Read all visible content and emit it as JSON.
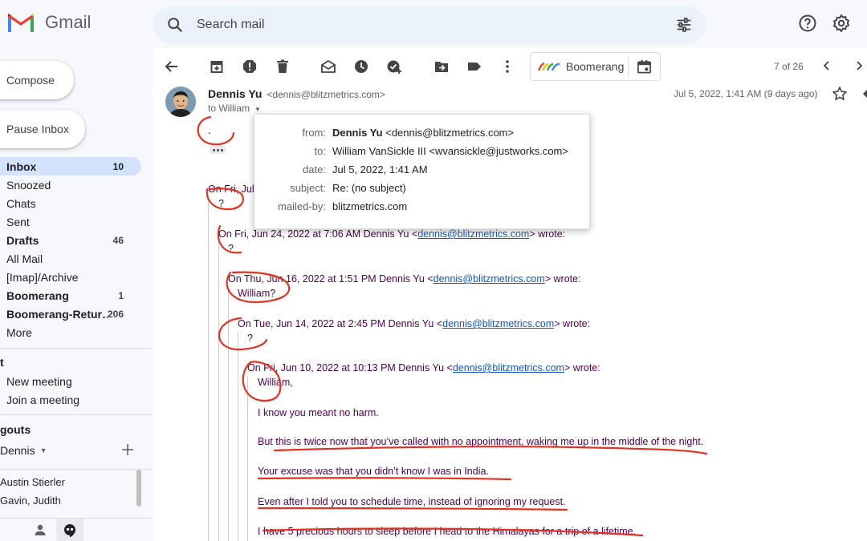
{
  "app": {
    "name": "Gmail"
  },
  "search": {
    "placeholder": "Search mail"
  },
  "sidebar": {
    "compose_label": "Compose",
    "pause_label": "Pause Inbox",
    "items": [
      {
        "label": "Inbox",
        "count": "10",
        "bold": true,
        "active": true
      },
      {
        "label": "Snoozed",
        "count": ""
      },
      {
        "label": "Chats",
        "count": ""
      },
      {
        "label": "Sent",
        "count": ""
      },
      {
        "label": "Drafts",
        "count": "46",
        "bold": true
      },
      {
        "label": "All Mail",
        "count": ""
      },
      {
        "label": "[Imap]/Archive",
        "count": ""
      },
      {
        "label": "Boomerang",
        "count": "1",
        "bold": true
      },
      {
        "label": "Boomerang-Retur…",
        "count": "206",
        "bold": true
      },
      {
        "label": "More",
        "count": ""
      }
    ],
    "meet_header": "t",
    "meet_items": [
      "New meeting",
      "Join a meeting"
    ],
    "hangouts_header": "gouts",
    "hangouts_user": "Dennis",
    "contacts": [
      "Austin Stierler",
      "Gavin, Judith"
    ]
  },
  "toolbar": {
    "boomerang_label": "Boomerang",
    "pager": "7 of 26"
  },
  "message": {
    "sender_name": "Dennis Yu",
    "sender_email": "<dennis@blitzmetrics.com>",
    "to": "to William",
    "date": "Jul 5, 2022, 1:41 AM (9 days ago)",
    "body": "."
  },
  "details_popup": {
    "rows": [
      {
        "key": "from:",
        "value_bold": "Dennis Yu",
        "value": " <dennis@blitzmetrics.com>"
      },
      {
        "key": "to:",
        "value_bold": "",
        "value": "William VanSickle III <wvansickle@justworks.com>"
      },
      {
        "key": "date:",
        "value_bold": "",
        "value": "Jul 5, 2022, 1:41 AM"
      },
      {
        "key": "subject:",
        "value_bold": "",
        "value": "Re: (no subject)"
      },
      {
        "key": "mailed-by:",
        "value_bold": "",
        "value": "blitzmetrics.com"
      }
    ]
  },
  "thread": {
    "q1_head": "On Fri, Jul",
    "q1_body": "?",
    "q2_head_pre": "On Fri, Jun 24, 2022 at 7:06 AM Dennis Yu <",
    "q2_link": "dennis@blitzmetrics.com",
    "q2_head_post": "> wrote:",
    "q2_body": "?",
    "q3_head_pre": "On Thu, Jun 16, 2022 at 1:51 PM Dennis Yu <",
    "q3_link": "dennis@blitzmetrics.com",
    "q3_head_post": "> wrote:",
    "q3_body": "William?",
    "q4_head_pre": "On Tue, Jun 14, 2022 at 2:45 PM Dennis Yu <",
    "q4_link": "dennis@blitzmetrics.com",
    "q4_head_post": "> wrote:",
    "q4_body": "?",
    "q5_head_pre": "On Fri, Jun 10, 2022 at 10:13 PM Dennis Yu <",
    "q5_link": "dennis@blitzmetrics.com",
    "q5_head_post": "> wrote:",
    "q5_lines": [
      "William,",
      "I know you meant no harm.",
      "But this is twice now that you’ve called with no appointment, waking me up in the middle of the night.",
      "Your excuse was that you didn’t know I was in India.",
      "Even after I told you to schedule time, instead of ignoring my request.",
      "I have 5 precious hours to sleep before I head to the Himalayas for a trip of a lifetime."
    ]
  },
  "colors": {
    "annotation": "#e0321e",
    "link": "#1155cc",
    "quote_text": "#500050",
    "active_nav": "#d3e3fd"
  }
}
